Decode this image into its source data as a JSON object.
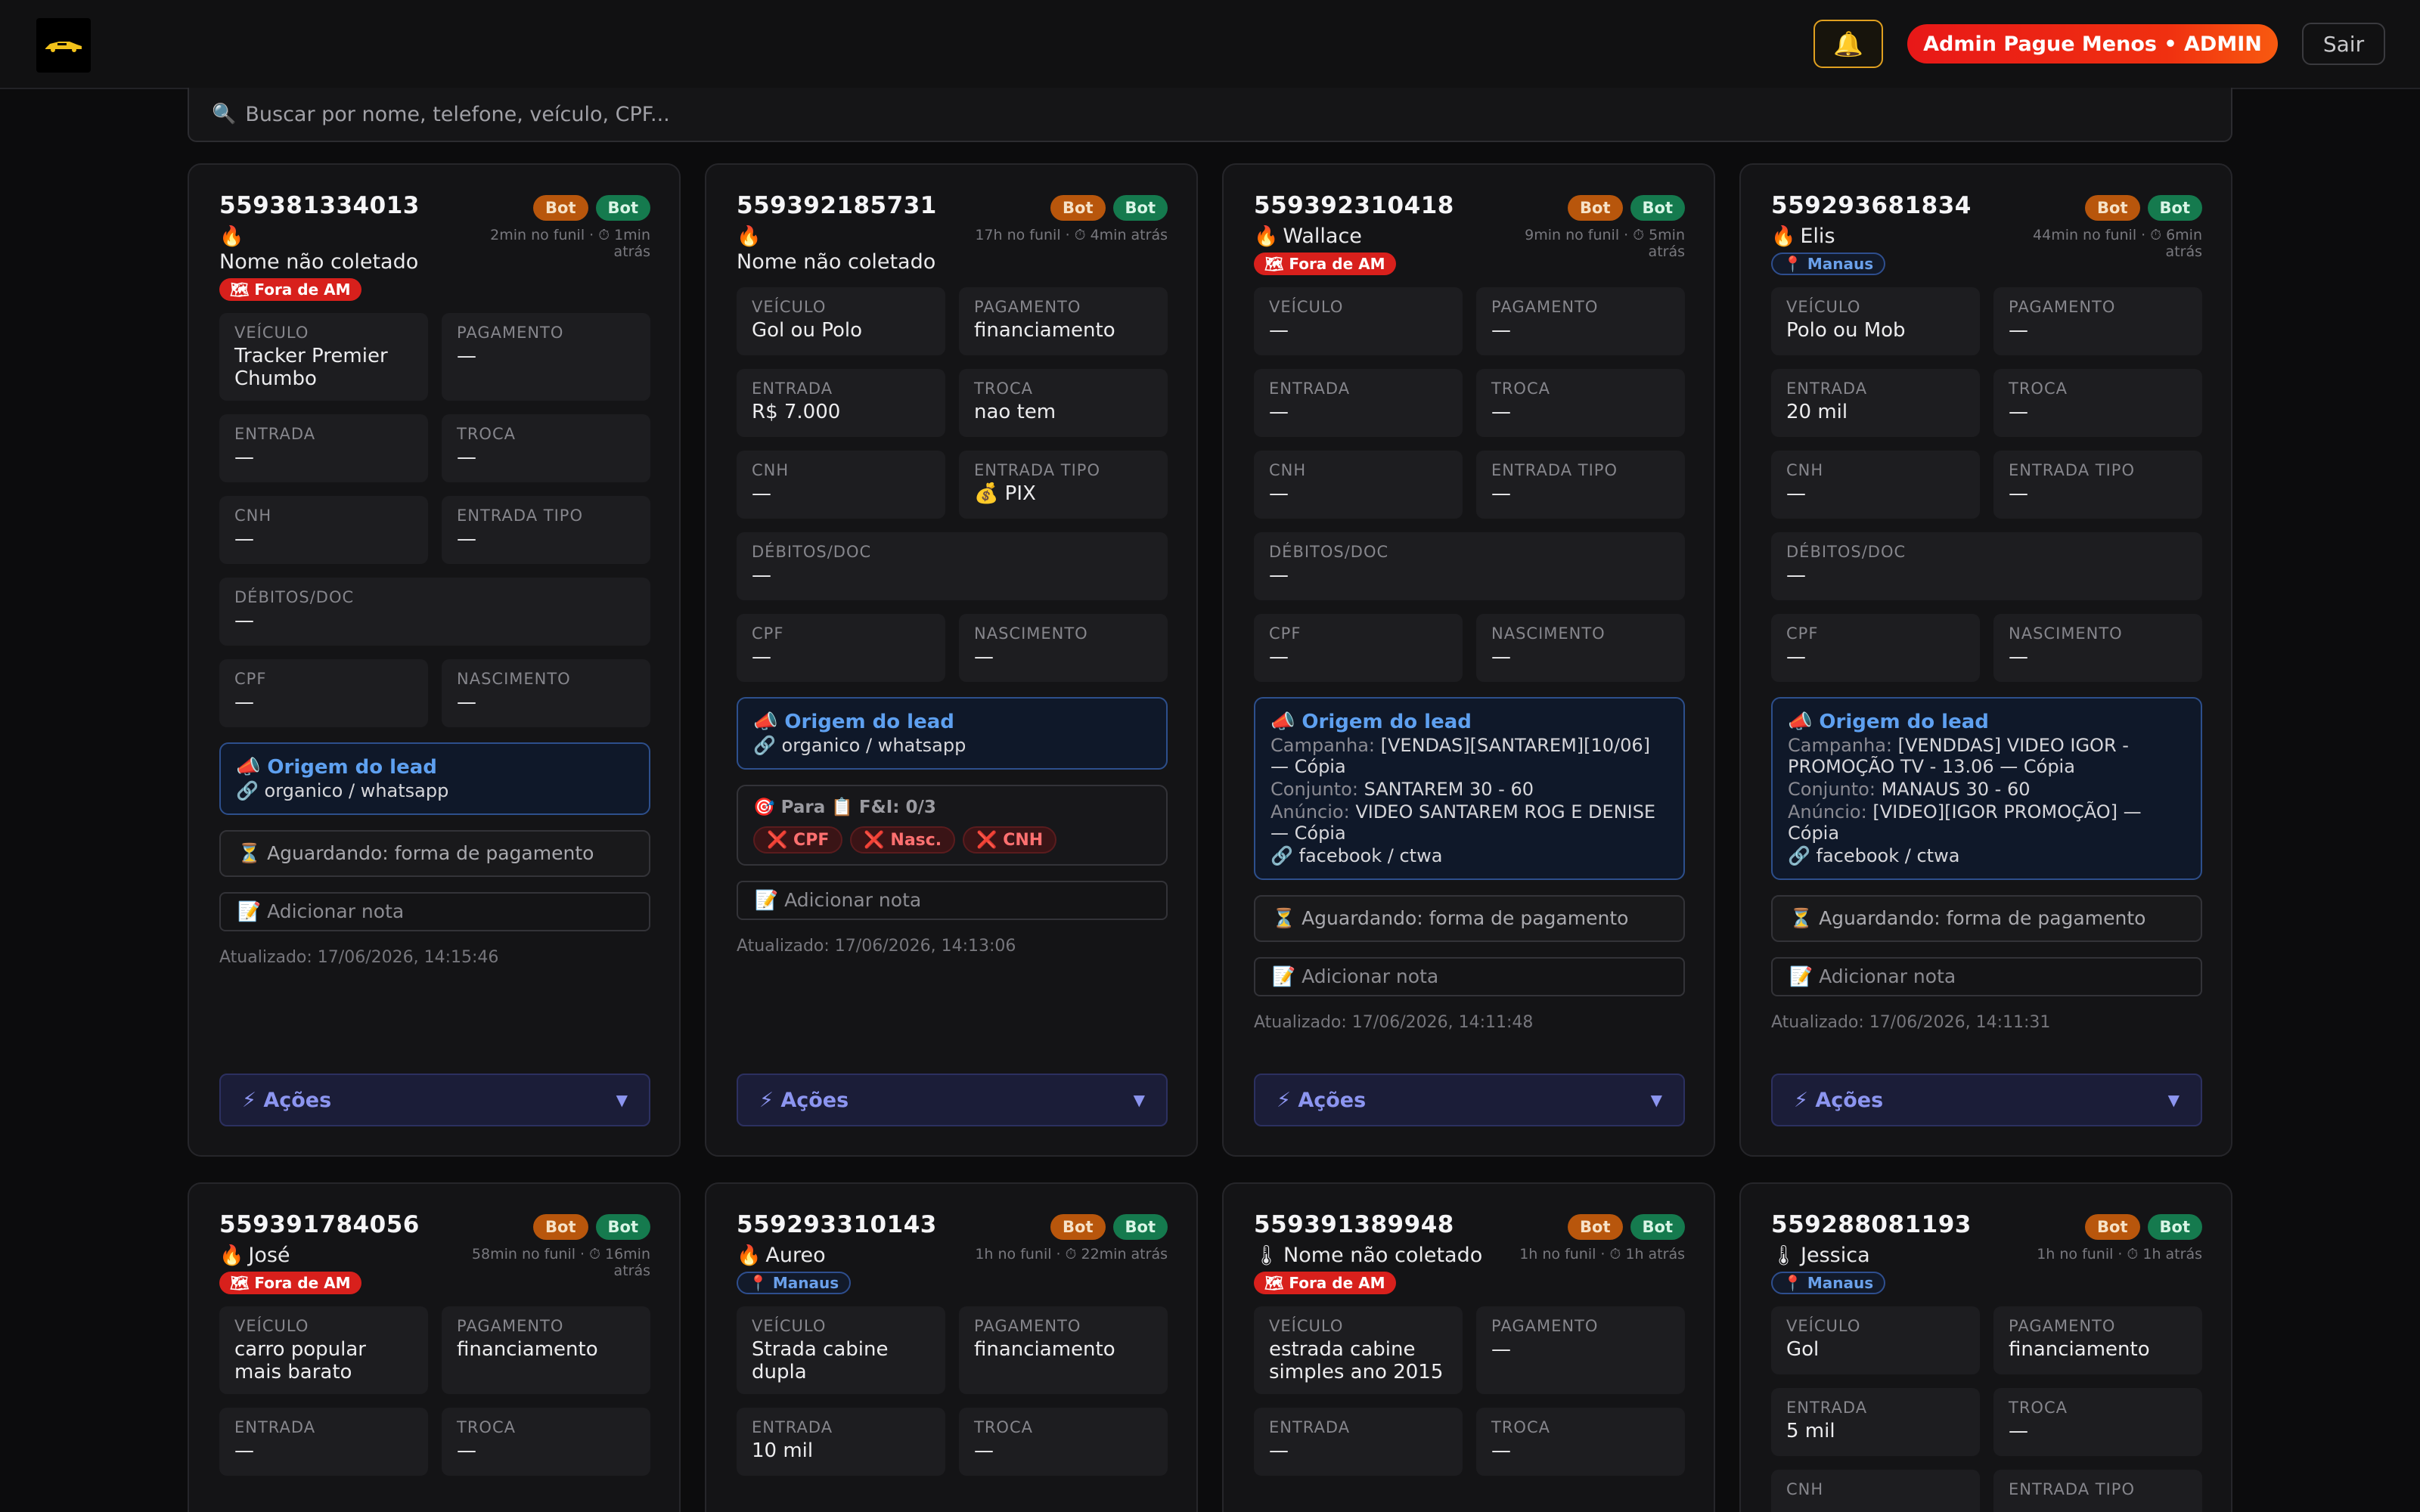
{
  "header": {
    "bell_icon": "🔔",
    "admin_label": "Admin Pague Menos • ADMIN",
    "logout_label": "Sair"
  },
  "search": {
    "placeholder": "Buscar por nome, telefone, veículo, CPF...",
    "icon": "🔍"
  },
  "labels": {
    "veiculo": "VEÍCULO",
    "pagamento": "PAGAMENTO",
    "entrada": "ENTRADA",
    "troca": "TROCA",
    "cnh": "CNH",
    "entrada_tipo": "ENTRADA TIPO",
    "debitos": "DÉBITOS/DOC",
    "cpf": "CPF",
    "nascimento": "NASCIMENTO",
    "origem": "📣 Origem do lead",
    "campanha": "Campanha:",
    "conjunto": "Conjunto:",
    "anuncio": "Anúncio:",
    "acoes": "⚡ Ações",
    "caret": "▼",
    "nota": "📝 Adicionar nota"
  },
  "cards": [
    {
      "phone": "559381334013",
      "bot1": "Bot",
      "bot2": "Bot",
      "temp": "🔥",
      "name": "Nome não coletado",
      "time": "2min no funil · ⏱ 1min atrás",
      "tag": "🗺 Fora de AM",
      "veiculo": "Tracker Premier Chumbo",
      "pagamento": "—",
      "entrada": "—",
      "troca": "—",
      "cnh": "—",
      "entrada_tipo": "—",
      "debitos": "—",
      "cpf": "—",
      "nascimento": "—",
      "source": "🔗 organico / whatsapp",
      "waiting": "⏳ Aguardando: forma de pagamento",
      "updated": "Atualizado: 17/06/2026, 14:15:46"
    },
    {
      "phone": "559392185731",
      "bot1": "Bot",
      "bot2": "Bot",
      "temp": "🔥",
      "name": "Nome não coletado",
      "time": "17h no funil · ⏱ 4min atrás",
      "veiculo": "Gol ou Polo",
      "pagamento": "financiamento",
      "entrada": "R$ 7.000",
      "troca": "nao tem",
      "cnh": "—",
      "entrada_tipo": "💰 PIX",
      "debitos": "—",
      "cpf": "—",
      "nascimento": "—",
      "source": "🔗 organico / whatsapp",
      "fi_title": "🎯 Para 📋 F&I: 0/3",
      "fi_chips": [
        "❌ CPF",
        "❌ Nasc.",
        "❌ CNH"
      ],
      "updated": "Atualizado: 17/06/2026, 14:13:06"
    },
    {
      "phone": "559392310418",
      "bot1": "Bot",
      "bot2": "Bot",
      "temp": "🔥",
      "name": "Wallace",
      "time": "9min no funil · ⏱ 5min atrás",
      "tag": "🗺 Fora de AM",
      "veiculo": "—",
      "pagamento": "—",
      "entrada": "—",
      "troca": "—",
      "cnh": "—",
      "entrada_tipo": "—",
      "debitos": "—",
      "cpf": "—",
      "nascimento": "—",
      "campanha": "[VENDAS][SANTAREM][10/06] — Cópia",
      "conjunto": "SANTAREM 30 - 60",
      "anuncio": "VIDEO SANTAREM ROG E DENISE — Cópia",
      "source": "🔗 facebook / ctwa",
      "waiting": "⏳ Aguardando: forma de pagamento",
      "updated": "Atualizado: 17/06/2026, 14:11:48"
    },
    {
      "phone": "559293681834",
      "bot1": "Bot",
      "bot2": "Bot",
      "temp": "🔥",
      "name": "Elis",
      "time": "44min no funil · ⏱ 6min atrás",
      "tag": "📍 Manaus",
      "veiculo": "Polo ou Mob",
      "pagamento": "—",
      "entrada": "20 mil",
      "troca": "—",
      "cnh": "—",
      "entrada_tipo": "—",
      "debitos": "—",
      "cpf": "—",
      "nascimento": "—",
      "campanha": "[VENDDAS] VIDEO IGOR - PROMOÇÃO TV - 13.06 — Cópia",
      "conjunto": "MANAUS 30 - 60",
      "anuncio": "[VIDEO][IGOR PROMOÇÃO] — Cópia",
      "source": "🔗 facebook / ctwa",
      "waiting": "⏳ Aguardando: forma de pagamento",
      "updated": "Atualizado: 17/06/2026, 14:11:31"
    },
    {
      "phone": "559391784056",
      "bot1": "Bot",
      "bot2": "Bot",
      "temp": "🔥",
      "name": "José",
      "time": "58min no funil · ⏱ 16min atrás",
      "tag": "🗺 Fora de AM",
      "veiculo": "carro popular mais barato",
      "pagamento": "financiamento",
      "entrada": "—",
      "troca": "—"
    },
    {
      "phone": "559293310143",
      "bot1": "Bot",
      "bot2": "Bot",
      "temp": "🔥",
      "name": "Aureo",
      "time": "1h no funil · ⏱ 22min atrás",
      "tag": "📍 Manaus",
      "veiculo": "Strada cabine dupla",
      "pagamento": "financiamento",
      "entrada": "10 mil",
      "troca": "—"
    },
    {
      "phone": "559391389948",
      "bot1": "Bot",
      "bot2": "Bot",
      "temp": "🌡",
      "name": "Nome não coletado",
      "time": "1h no funil · ⏱ 1h atrás",
      "tag": "🗺 Fora de AM",
      "veiculo": "estrada cabine simples ano 2015",
      "pagamento": "—",
      "entrada": "—",
      "troca": "—"
    },
    {
      "phone": "559288081193",
      "bot1": "Bot",
      "bot2": "Bot",
      "temp": "🌡",
      "name": "Jessica",
      "time": "1h no funil · ⏱ 1h atrás",
      "tag": "📍 Manaus",
      "veiculo": "Gol",
      "pagamento": "financiamento",
      "entrada": "5 mil",
      "troca": "—",
      "cnh": "",
      "entrada_tipo": ""
    }
  ],
  "colors": {
    "accent_orange": "#b8560c",
    "accent_green": "#157a4e",
    "danger": "#d8201c",
    "info": "#5ea0f0",
    "actions": "#8c95f0"
  }
}
